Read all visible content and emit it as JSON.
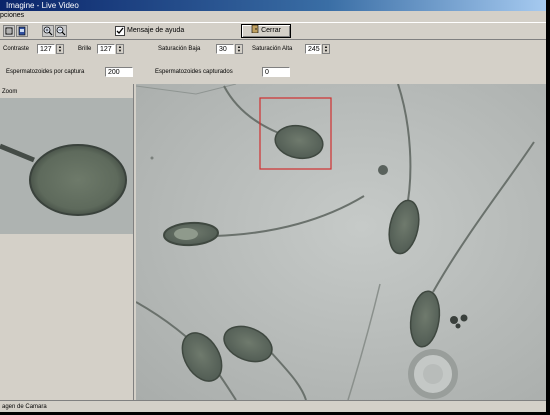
{
  "window": {
    "title": "Imagine - Live Video"
  },
  "menu": {
    "label": "pciones"
  },
  "toolbar": {
    "help_checkbox_label": "Mensaje de ayuda",
    "help_checked": true,
    "close_button_label": "Cerrar",
    "icons": [
      "list-icon",
      "clipboard-icon",
      "zoom-in-icon",
      "zoom-out-icon",
      "door-icon"
    ]
  },
  "controls": {
    "contrast": {
      "label": "Contraste",
      "value": "127"
    },
    "brightness": {
      "label": "Brille",
      "value": "127"
    },
    "sat_low": {
      "label": "Saturación Baja",
      "value": "30"
    },
    "sat_high": {
      "label": "Saturación Alta",
      "value": "245"
    },
    "per_capture": {
      "label": "Espermatozoides por captura",
      "value": "200"
    },
    "captured": {
      "label": "Espermatozoides capturados",
      "value": "0"
    }
  },
  "zoom_panel": {
    "label": "Zoom"
  },
  "status": {
    "text": "agen de Camara"
  },
  "colors": {
    "title_start": "#0a246a",
    "title_end": "#a6caf0",
    "selection": "#d03030",
    "window_bg": "#d4d0c8"
  }
}
